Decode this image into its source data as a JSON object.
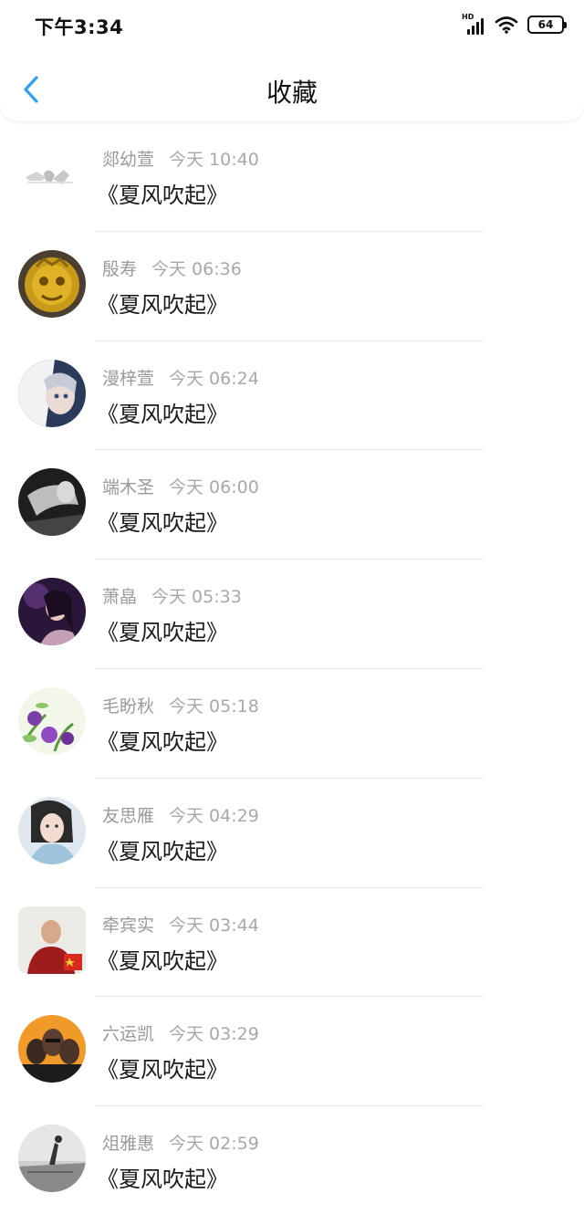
{
  "status_bar": {
    "time": "下午3:34",
    "signal_label": "HD",
    "battery": "64"
  },
  "header": {
    "title": "收藏"
  },
  "items": [
    {
      "author": "郯幼萱",
      "time": "今天 10:40",
      "title": "《夏风吹起》",
      "avatar": "sketch"
    },
    {
      "author": "殷寿",
      "time": "今天 06:36",
      "title": "《夏风吹起》",
      "avatar": "golden-mask"
    },
    {
      "author": "漫梓萱",
      "time": "今天 06:24",
      "title": "《夏风吹起》",
      "avatar": "anime"
    },
    {
      "author": "端木圣",
      "time": "今天 06:00",
      "title": "《夏风吹起》",
      "avatar": "bw-portrait"
    },
    {
      "author": "萧皛",
      "time": "今天 05:33",
      "title": "《夏风吹起》",
      "avatar": "woman-purple"
    },
    {
      "author": "毛盼秋",
      "time": "今天 05:18",
      "title": "《夏风吹起》",
      "avatar": "flowers"
    },
    {
      "author": "友思雁",
      "time": "今天 04:29",
      "title": "《夏风吹起》",
      "avatar": "woman-hanfu"
    },
    {
      "author": "牵宾实",
      "time": "今天 03:44",
      "title": "《夏风吹起》",
      "avatar": "man-red"
    },
    {
      "author": "六运凯",
      "time": "今天 03:29",
      "title": "《夏风吹起》",
      "avatar": "group-orange"
    },
    {
      "author": "俎雅惠",
      "time": "今天 02:59",
      "title": "《夏风吹起》",
      "avatar": "bw-scene"
    }
  ],
  "colors": {
    "accent": "#2f9ef5",
    "meta_text": "#9a9a9a",
    "title_text": "#1a1a1a"
  }
}
